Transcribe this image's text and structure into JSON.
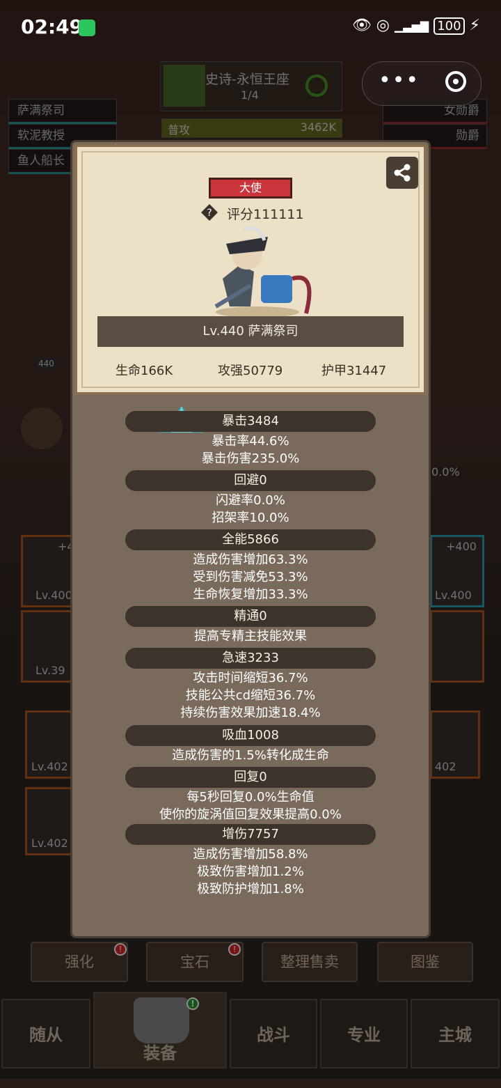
{
  "status_bar": {
    "time": "02:49",
    "battery": "100"
  },
  "capsule": {
    "more": "•••"
  },
  "background": {
    "dungeon_title": "史诗-永恒王座",
    "dungeon_progress": "1/4",
    "attack_label": "普攻",
    "attack_value": "3462K",
    "left_list": [
      "萨满祭司",
      "软泥教授",
      "鱼人船长"
    ],
    "right_list": [
      "女勋爵",
      "勋爵"
    ],
    "side_level": "440",
    "side_percent": "0.0%",
    "item_levels": [
      "Lv.400",
      "Lv.39",
      "Lv.402",
      "Lv.402",
      "Lv.400",
      "402"
    ],
    "item_bonus": [
      "+4",
      "+400"
    ],
    "buttons": [
      "强化",
      "宝石",
      "整理售卖",
      "图鉴"
    ],
    "nav": [
      "随从",
      "装备",
      "战斗",
      "专业",
      "主城"
    ]
  },
  "hero_card": {
    "class_badge": "大使",
    "rating": "评分111111",
    "name": "Lv.440 萨满祭司",
    "hp": "生命166K",
    "attack": "攻强50779",
    "armor": "护甲31447"
  },
  "attributes": [
    {
      "title": "暴击3484",
      "lines": [
        "暴击率44.6%",
        "暴击伤害235.0%"
      ]
    },
    {
      "title": "回避0",
      "lines": [
        "闪避率0.0%",
        "招架率10.0%"
      ]
    },
    {
      "title": "全能5866",
      "lines": [
        "造成伤害增加63.3%",
        "受到伤害减免53.3%",
        "生命恢复增加33.3%"
      ]
    },
    {
      "title": "精通0",
      "lines": [
        "提高专精主技能效果"
      ]
    },
    {
      "title": "急速3233",
      "lines": [
        "攻击时间缩短36.7%",
        "技能公共cd缩短36.7%",
        "持续伤害效果加速18.4%"
      ]
    },
    {
      "title": "吸血1008",
      "lines": [
        "造成伤害的1.5%转化成生命"
      ]
    },
    {
      "title": "回复0",
      "lines": [
        "每5秒回复0.0%生命值",
        "使你的旋涡值回复效果提高0.0%"
      ]
    },
    {
      "title": "增伤7757",
      "lines": [
        "造成伤害增加58.8%",
        "极致伤害增加1.2%",
        "极致防护增加1.8%"
      ]
    }
  ]
}
